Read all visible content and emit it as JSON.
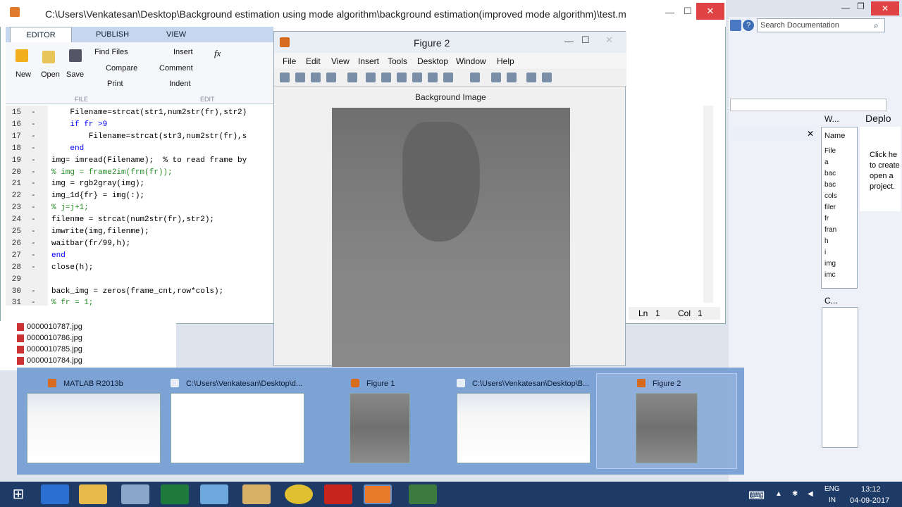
{
  "editor": {
    "title": "C:\\Users\\Venkatesan\\Desktop\\Background estimation using mode algorithm\\background estimation(improved mode algorithm)\\test.m",
    "tabs": [
      "EDITOR",
      "PUBLISH",
      "VIEW"
    ],
    "buttons": {
      "new": "New",
      "open": "Open",
      "save": "Save",
      "find_files": "Find Files",
      "compare": "Compare",
      "print": "Print",
      "insert": "Insert",
      "comment": "Comment",
      "indent": "Indent",
      "fx": "fx"
    },
    "sections": {
      "file": "FILE",
      "edit": "EDIT"
    },
    "lines": [
      {
        "n": "15",
        "code": "    Filename=strcat(str1,num2str(fr),str2)"
      },
      {
        "n": "16",
        "code": "    if fr >9"
      },
      {
        "n": "17",
        "code": "        Filename=strcat(str3,num2str(fr),s"
      },
      {
        "n": "18",
        "code": "    end"
      },
      {
        "n": "19",
        "code": "img= imread(Filename);  % to read frame by"
      },
      {
        "n": "20",
        "code": "% img = frame2im(frm(fr));"
      },
      {
        "n": "21",
        "code": "img = rgb2gray(img);"
      },
      {
        "n": "22",
        "code": "img_1d{fr} = img(:);"
      },
      {
        "n": "23",
        "code": "% j=j+1;"
      },
      {
        "n": "24",
        "code": "filenme = strcat(num2str(fr),str2);"
      },
      {
        "n": "25",
        "code": "imwrite(img,filenme);"
      },
      {
        "n": "26",
        "code": "waitbar(fr/99,h);"
      },
      {
        "n": "27",
        "code": "end"
      },
      {
        "n": "28",
        "code": "close(h);"
      },
      {
        "n": "29",
        "code": ""
      },
      {
        "n": "30",
        "code": "back_img = zeros(frame_cnt,row*cols);"
      },
      {
        "n": "31",
        "code": "% fr = 1;"
      }
    ],
    "status": {
      "ln_label": "Ln",
      "ln": "1",
      "col_label": "Col",
      "col": "1"
    }
  },
  "search_placeholder": "Search Documentation",
  "workspace": {
    "title": "W...",
    "deploy": "Deplo",
    "header": "Name",
    "items": [
      "File",
      "a",
      "bac",
      "bac",
      "cols",
      "filer",
      "fr",
      "fran",
      "h",
      "i",
      "img",
      "imc"
    ],
    "help_text": [
      "Click he",
      "to create",
      "open a",
      "project."
    ],
    "cmd_title": "C..."
  },
  "files": [
    "0000010787.jpg",
    "0000010786.jpg",
    "0000010785.jpg",
    "0000010784.jpg"
  ],
  "figure": {
    "title": "Figure 2",
    "menu": [
      "File",
      "Edit",
      "View",
      "Insert",
      "Tools",
      "Desktop",
      "Window",
      "Help"
    ],
    "axes_title": "Background Image"
  },
  "previews": [
    {
      "label": "MATLAB R2013b"
    },
    {
      "label": "C:\\Users\\Venkatesan\\Desktop\\d..."
    },
    {
      "label": "Figure 1"
    },
    {
      "label": "C:\\Users\\Venkatesan\\Desktop\\B..."
    },
    {
      "label": "Figure 2"
    }
  ],
  "tray": {
    "lang1": "ENG",
    "lang2": "IN",
    "time": "13:12",
    "date": "04-09-2017"
  },
  "colors": {
    "taskbar": "#1d3b66",
    "strip": "#7aa0d4",
    "comment": "#228b22",
    "keyword": "#0000ff"
  }
}
